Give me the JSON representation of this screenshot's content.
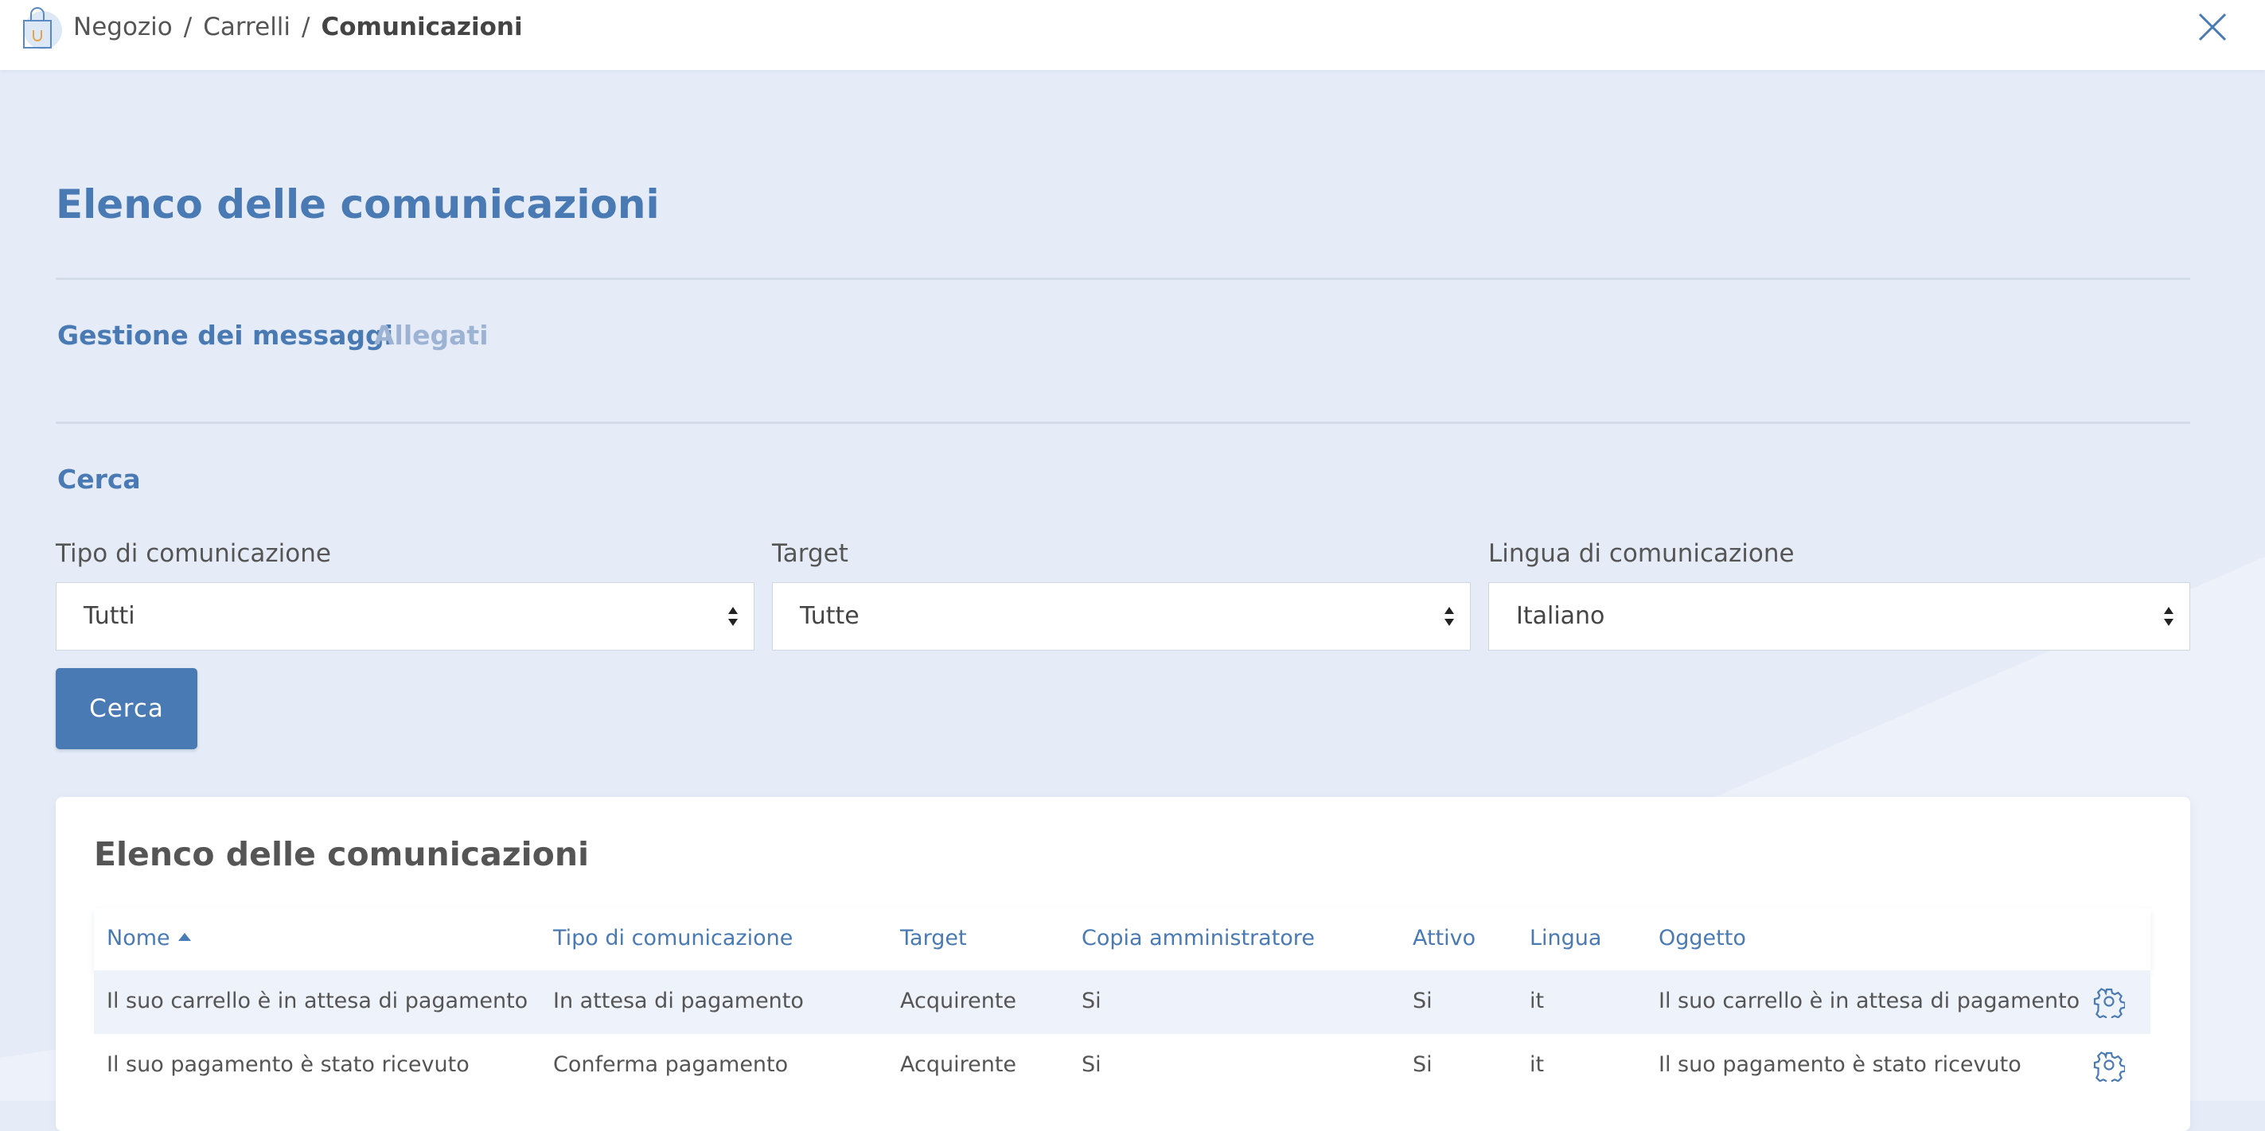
{
  "breadcrumb": {
    "items": [
      "Negozio",
      "Carrelli"
    ],
    "current": "Comunicazioni",
    "separator": "/"
  },
  "page": {
    "title": "Elenco delle comunicazioni"
  },
  "tabs": [
    {
      "label": "Gestione dei messaggi",
      "active": true
    },
    {
      "label": "Allegati",
      "active": false
    }
  ],
  "search": {
    "section_label": "Cerca",
    "fields": [
      {
        "label": "Tipo di comunicazione",
        "value": "Tutti"
      },
      {
        "label": "Target",
        "value": "Tutte"
      },
      {
        "label": "Lingua di comunicazione",
        "value": "Italiano"
      }
    ],
    "button_label": "Cerca"
  },
  "table": {
    "title": "Elenco delle comunicazioni",
    "columns": [
      "Nome",
      "Tipo di comunicazione",
      "Target",
      "Copia amministratore",
      "Attivo",
      "Lingua",
      "Oggetto"
    ],
    "sorted_column": "Nome",
    "sort_direction": "asc",
    "rows": [
      [
        "Il suo carrello è in attesa di pagamento",
        "In attesa di pagamento",
        "Acquirente",
        "Si",
        "Si",
        "it",
        "Il suo carrello è in attesa di pagamento"
      ],
      [
        "Il suo pagamento è stato ricevuto",
        "Conferma pagamento",
        "Acquirente",
        "Si",
        "Si",
        "it",
        "Il suo pagamento è stato ricevuto"
      ]
    ]
  },
  "icons": {
    "logo": "shopping-bag-icon",
    "close": "close-icon",
    "row_action": "gear-icon",
    "sort": "sort-asc-icon"
  },
  "colors": {
    "accent": "#4a7ab4",
    "accent_light": "#9db3d4",
    "background": "#e6ecf7",
    "row_highlight": "#eef2fa"
  }
}
